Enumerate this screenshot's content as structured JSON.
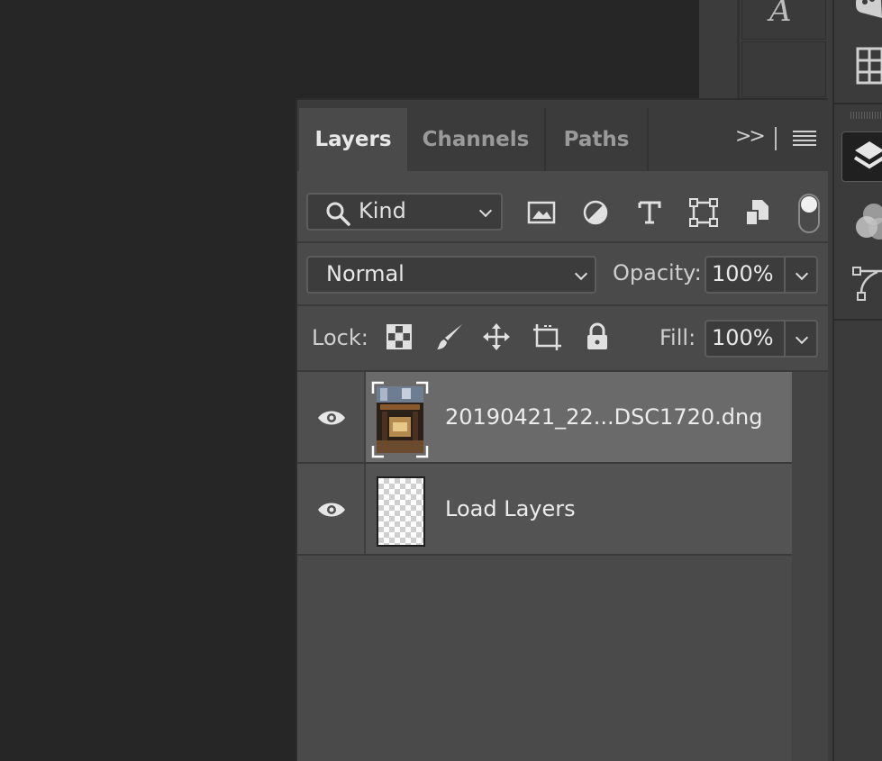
{
  "panel": {
    "tabs": [
      {
        "label": "Layers",
        "active": true
      },
      {
        "label": "Channels",
        "active": false
      },
      {
        "label": "Paths",
        "active": false
      }
    ],
    "expand_label": ">>"
  },
  "filter": {
    "kind_label": "Kind",
    "icons": [
      "image-filter-icon",
      "adjustment-filter-icon",
      "type-filter-icon",
      "shape-filter-icon",
      "smart-object-filter-icon"
    ]
  },
  "blend": {
    "mode": "Normal",
    "opacity_label": "Opacity:",
    "opacity_value": "100%"
  },
  "lock": {
    "label": "Lock:",
    "fill_label": "Fill:",
    "fill_value": "100%"
  },
  "layers": [
    {
      "name": "20190421_22...DSC1720.dng",
      "selected": true,
      "visible": true
    },
    {
      "name": "Load Layers",
      "selected": false,
      "visible": true
    }
  ],
  "dock": {
    "glyph": "A"
  },
  "colors": {
    "canvas": "#262626",
    "panel": "#4a4a4a",
    "selected_layer": "#6a6a6a"
  }
}
